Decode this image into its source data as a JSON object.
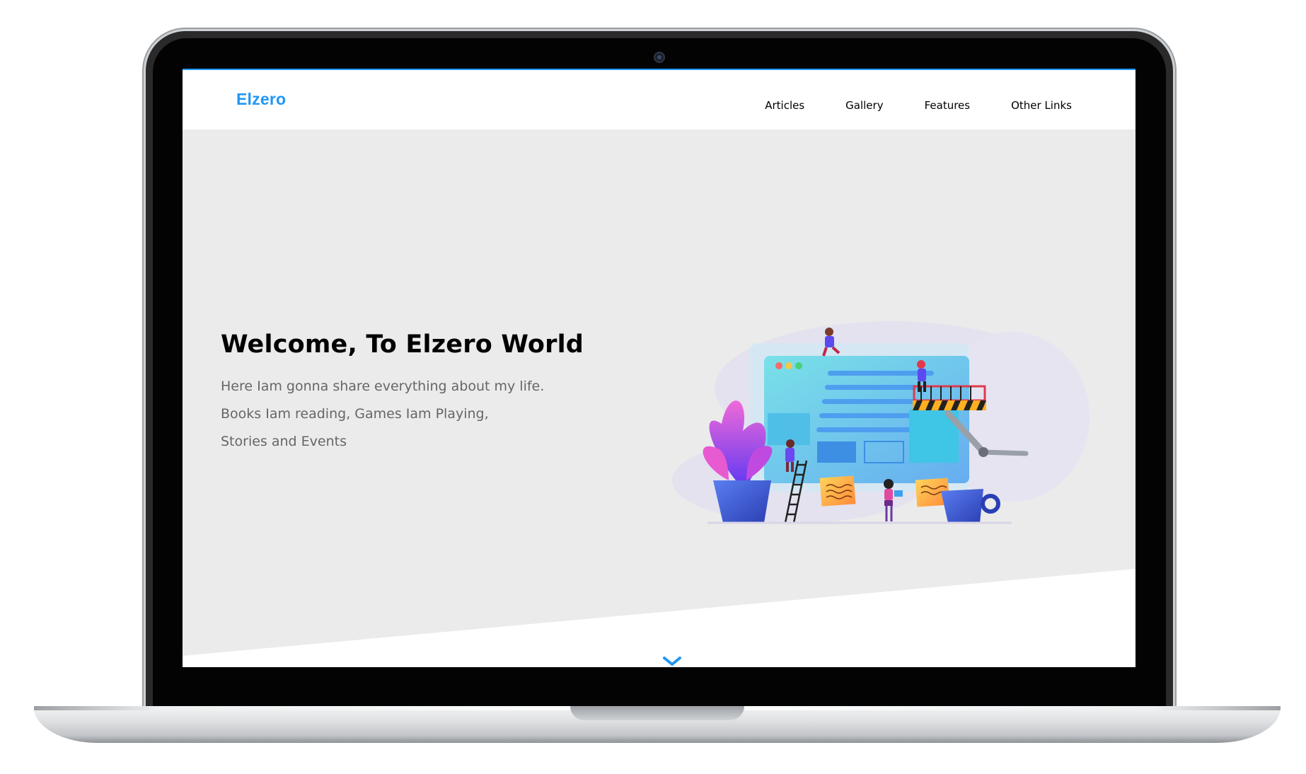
{
  "site": {
    "logo": "Elzero",
    "nav": [
      {
        "label": "Articles"
      },
      {
        "label": "Gallery"
      },
      {
        "label": "Features"
      },
      {
        "label": "Other Links"
      }
    ]
  },
  "hero": {
    "title": "Welcome, To Elzero World",
    "lines": [
      "Here Iam gonna share everything about my life.",
      "Books Iam reading, Games Iam Playing,",
      "Stories and Events"
    ]
  },
  "icons": {
    "scroll": "chevron-down-icon",
    "illustration": "web-builders-illustration"
  },
  "colors": {
    "brand": "#2196f3",
    "hero_bg": "#ebebeb",
    "title": "#000000",
    "body_text": "#666666"
  }
}
